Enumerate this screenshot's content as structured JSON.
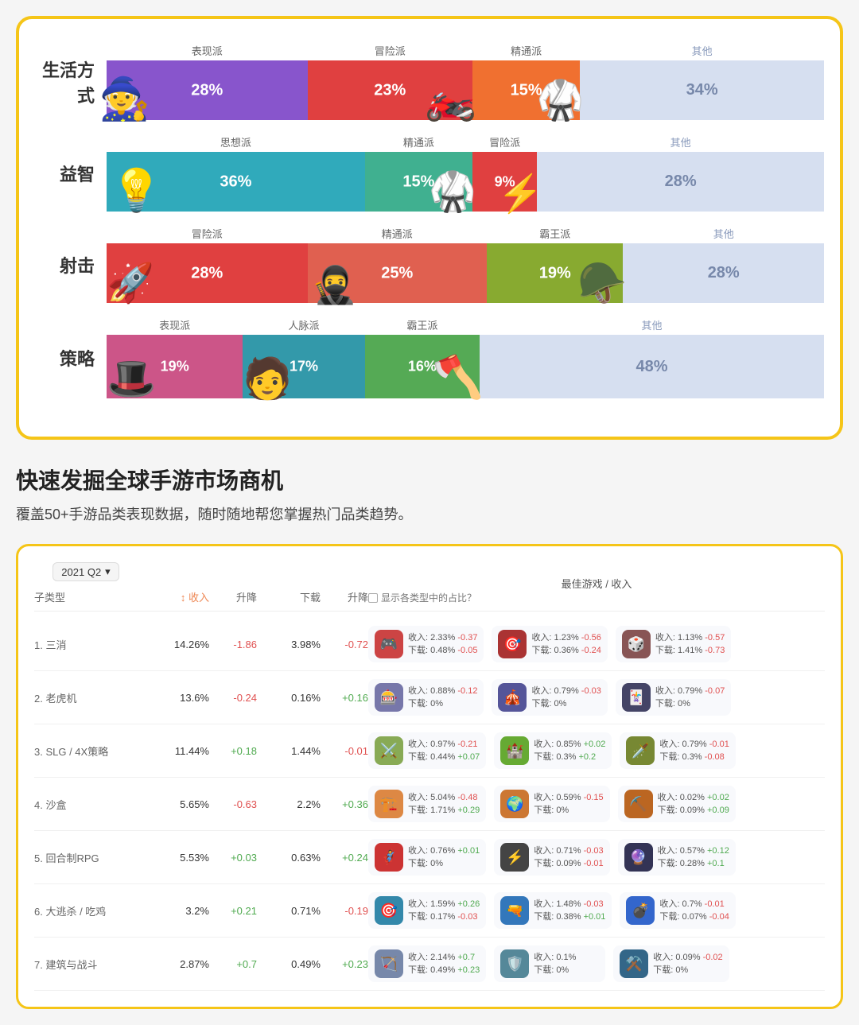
{
  "topCard": {
    "rows": [
      {
        "id": "lifestyle",
        "label": "生活方式",
        "segments": [
          {
            "label": "表现派",
            "pct": "28%",
            "color": "purple",
            "width": "28%"
          },
          {
            "label": "冒险派",
            "pct": "23%",
            "color": "red-orange",
            "width": "23%"
          },
          {
            "label": "精通派",
            "pct": "15%",
            "color": "orange",
            "width": "15%"
          },
          {
            "label": "其他",
            "pct": "34%",
            "color": "other-seg",
            "width": "auto"
          }
        ]
      },
      {
        "id": "puzzle",
        "label": "益智",
        "segments": [
          {
            "label": "思想派",
            "pct": "36%",
            "color": "cyan",
            "width": "36%"
          },
          {
            "label": "精通派",
            "pct": "15%",
            "color": "teal-green",
            "width": "15%"
          },
          {
            "label": "冒险派",
            "pct": "9%",
            "color": "red-orange",
            "width": "9%"
          },
          {
            "label": "其他",
            "pct": "28%",
            "color": "other-seg",
            "width": "auto"
          }
        ]
      },
      {
        "id": "shoot",
        "label": "射击",
        "segments": [
          {
            "label": "冒险派",
            "pct": "28%",
            "color": "red-orange",
            "width": "28%"
          },
          {
            "label": "精通派",
            "pct": "25%",
            "color": "salmon",
            "width": "25%"
          },
          {
            "label": "霸王派",
            "pct": "19%",
            "color": "olive",
            "width": "19%"
          },
          {
            "label": "其他",
            "pct": "28%",
            "color": "other-seg",
            "width": "auto"
          }
        ]
      },
      {
        "id": "strategy",
        "label": "策略",
        "segments": [
          {
            "label": "表现派",
            "pct": "19%",
            "color": "pink2",
            "width": "19%"
          },
          {
            "label": "人脉派",
            "pct": "17%",
            "color": "teal2",
            "width": "17%"
          },
          {
            "label": "霸王派",
            "pct": "16%",
            "color": "green2",
            "width": "16%"
          },
          {
            "label": "其他",
            "pct": "48%",
            "color": "other-seg",
            "width": "auto"
          }
        ]
      }
    ]
  },
  "sectionTitle": "快速发掘全球手游市场商机",
  "sectionSubtitle": "覆盖50+手游品类表现数据，随时随地帮您掌握热门品类趋势。",
  "tableCard": {
    "quarterBadge": "2021 Q2",
    "headers": {
      "subtype": "子类型",
      "revenue": "收入",
      "rise1": "升降",
      "download": "下载",
      "rise2": "升降",
      "bestGame": "最佳游戏 / 收入",
      "showRatio": "显示各类型中的占比？"
    },
    "rows": [
      {
        "rank": "1.",
        "name": "三消",
        "revenue": "14.26%",
        "rise1": "-1.86",
        "download": "3.98%",
        "rise2": "-0.72",
        "games": [
          {
            "icon": "🎮",
            "bg": "#c44",
            "stats": "收入: 2.33% -0.37\n下载: 0.48% -0.05"
          },
          {
            "icon": "🎯",
            "bg": "#a33",
            "stats": "收入: 1.23% -0.56\n下载: 0.36% -0.24"
          },
          {
            "icon": "🎲",
            "bg": "#855",
            "stats": "收入: 1.13% -0.57\n下载: 1.41% -0.73"
          }
        ]
      },
      {
        "rank": "2.",
        "name": "老虎机",
        "revenue": "13.6%",
        "rise1": "-0.24",
        "download": "0.16%",
        "rise2": "+0.16",
        "games": [
          {
            "icon": "🎰",
            "bg": "#77a",
            "stats": "收入: 0.88% -0.12\n下载: 0%"
          },
          {
            "icon": "🎪",
            "bg": "#559",
            "stats": "收入: 0.79% -0.03\n下载: 0%"
          },
          {
            "icon": "🃏",
            "bg": "#446",
            "stats": "收入: 0.79% -0.07\n下载: 0%"
          }
        ]
      },
      {
        "rank": "3.",
        "name": "SLG / 4X策略",
        "revenue": "11.44%",
        "rise1": "+0.18",
        "download": "1.44%",
        "rise2": "-0.01",
        "games": [
          {
            "icon": "⚔️",
            "bg": "#8a5",
            "stats": "收入: 0.97% -0.21\n下载: 0.44% +0.07"
          },
          {
            "icon": "🏰",
            "bg": "#6a3",
            "stats": "收入: 0.85% +0.02\n下载: 0.3% +0.2"
          },
          {
            "icon": "🗡️",
            "bg": "#783",
            "stats": "收入: 0.79% -0.01\n下载: 0.3% -0.08"
          }
        ]
      },
      {
        "rank": "4.",
        "name": "沙盒",
        "revenue": "5.65%",
        "rise1": "-0.63",
        "download": "2.2%",
        "rise2": "+0.36",
        "games": [
          {
            "icon": "🏗️",
            "bg": "#d84",
            "stats": "收入: 5.04% -0.48\n下载: 1.71% +0.29"
          },
          {
            "icon": "🌍",
            "bg": "#c73",
            "stats": "收入: 0.59% -0.15\n下载: 0%"
          },
          {
            "icon": "⛏️",
            "bg": "#b62",
            "stats": "收入: 0.02% +0.02\n下载: 0.09% +0.09"
          }
        ]
      },
      {
        "rank": "5.",
        "name": "回合制RPG",
        "revenue": "5.53%",
        "rise1": "+0.03",
        "download": "0.63%",
        "rise2": "+0.24",
        "games": [
          {
            "icon": "🦸",
            "bg": "#c33",
            "stats": "收入: 0.76% +0.01\n下载: 0%"
          },
          {
            "icon": "⚡",
            "bg": "#444",
            "stats": "收入: 0.71% -0.03\n下载: 0.09% -0.01"
          },
          {
            "icon": "🔮",
            "bg": "#335",
            "stats": "收入: 0.57% +0.12\n下载: 0.28% +0.1"
          }
        ]
      },
      {
        "rank": "6.",
        "name": "大逃杀 / 吃鸡",
        "revenue": "3.2%",
        "rise1": "+0.21",
        "download": "0.71%",
        "rise2": "-0.19",
        "games": [
          {
            "icon": "🎯",
            "bg": "#38a",
            "stats": "收入: 1.59% +0.26\n下载: 0.17% -0.03"
          },
          {
            "icon": "🔫",
            "bg": "#37b",
            "stats": "收入: 1.48% -0.03\n下载: 0.38% +0.01"
          },
          {
            "icon": "💣",
            "bg": "#36c",
            "stats": "收入: 0.7% -0.01\n下载: 0.07% -0.04"
          }
        ]
      },
      {
        "rank": "7.",
        "name": "建筑与战斗",
        "revenue": "2.87%",
        "rise1": "+0.7",
        "download": "0.49%",
        "rise2": "+0.23",
        "games": [
          {
            "icon": "🏹",
            "bg": "#78a",
            "stats": "收入: 2.14% +0.7\n下载: 0.49% +0.23"
          },
          {
            "icon": "🛡️",
            "bg": "#589",
            "stats": "收入: 0.1%\n下载: 0%"
          },
          {
            "icon": "⚒️",
            "bg": "#368",
            "stats": "收入: 0.09% -0.02\n下载: 0%"
          }
        ]
      }
    ]
  }
}
